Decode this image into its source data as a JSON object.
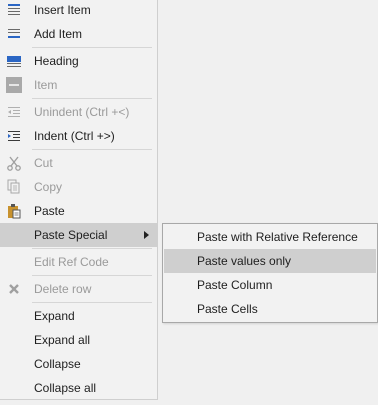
{
  "menu": {
    "insert_item": "Insert Item",
    "add_item": "Add Item",
    "heading": "Heading",
    "item": "Item",
    "unindent": "Unindent (Ctrl +<)",
    "indent": "Indent (Ctrl +>)",
    "cut": "Cut",
    "copy": "Copy",
    "paste": "Paste",
    "paste_special": "Paste Special",
    "edit_ref_code": "Edit Ref Code",
    "delete_row": "Delete row",
    "expand": "Expand",
    "expand_all": "Expand all",
    "collapse": "Collapse",
    "collapse_all": "Collapse all"
  },
  "submenu": {
    "paste_relative": "Paste with Relative Reference",
    "paste_values": "Paste values only",
    "paste_column": "Paste Column",
    "paste_cells": "Paste Cells"
  },
  "icons": {
    "insert_item": "insert-row-icon",
    "add_item": "add-row-icon",
    "heading": "heading-icon",
    "item": "item-icon",
    "unindent": "unindent-icon",
    "indent": "indent-icon",
    "cut": "scissors-icon",
    "copy": "copy-icon",
    "paste": "clipboard-icon",
    "delete_row": "x-icon",
    "submenu_arrow": "chevron-right-icon"
  },
  "colors": {
    "menu_bg": "#f2f2f2",
    "highlight": "#cfcfcf",
    "disabled_text": "#9a9a9a",
    "accent_blue": "#2b66c4"
  }
}
